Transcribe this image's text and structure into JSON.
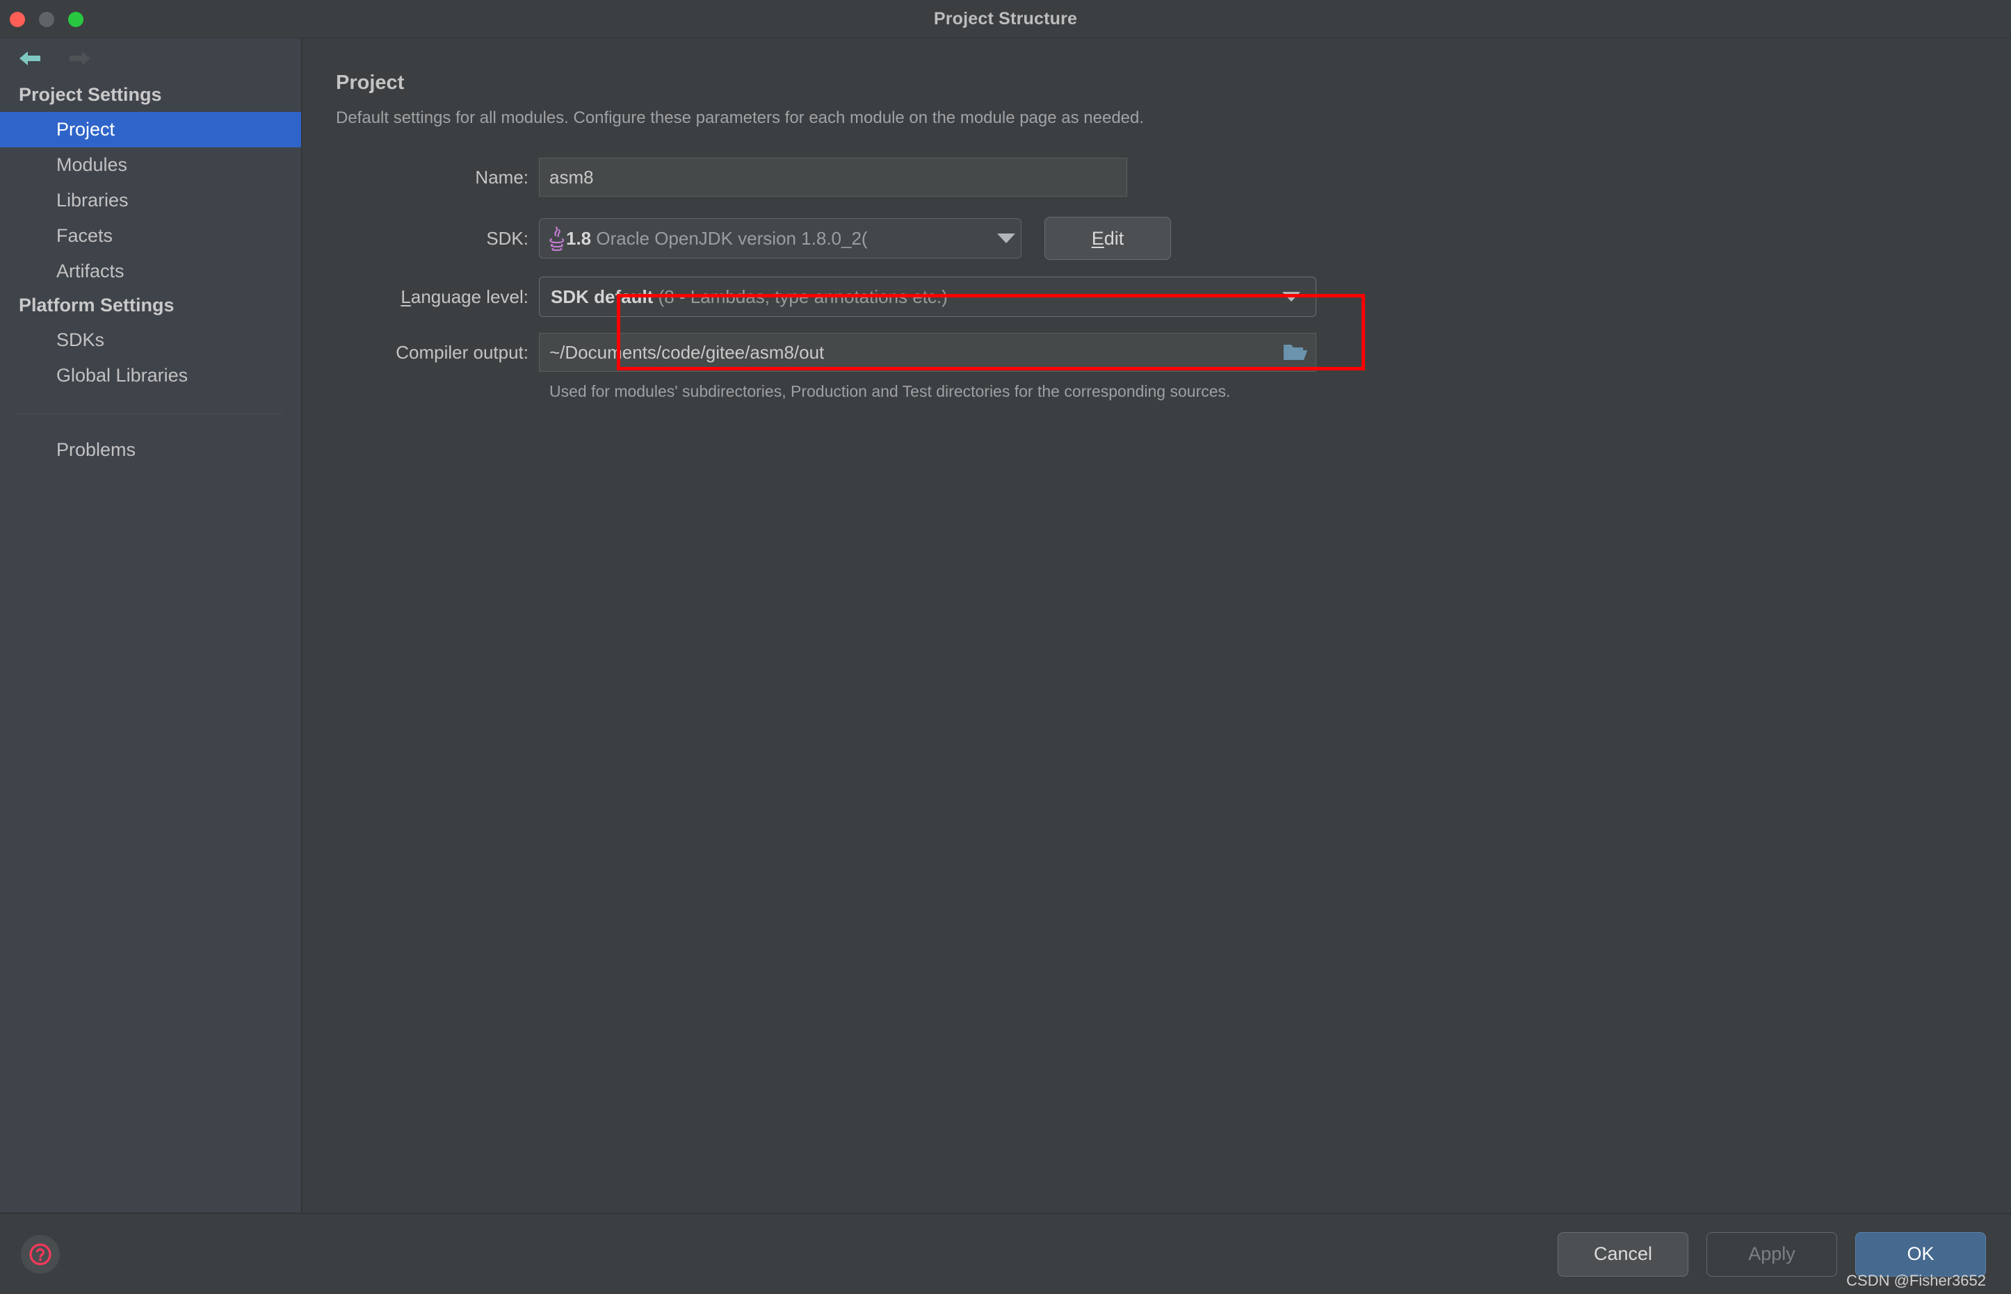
{
  "window": {
    "title": "Project Structure",
    "traffic_lights": [
      "close",
      "minimize",
      "zoom"
    ]
  },
  "nav": {
    "back_icon": "arrow-left-icon",
    "forward_icon": "arrow-right-icon",
    "back_color": "#7fc9c2",
    "forward_color": "#4f5356"
  },
  "sidebar": {
    "groups": [
      {
        "title": "Project Settings",
        "items": [
          {
            "label": "Project",
            "selected": true
          },
          {
            "label": "Modules",
            "selected": false
          },
          {
            "label": "Libraries",
            "selected": false
          },
          {
            "label": "Facets",
            "selected": false
          },
          {
            "label": "Artifacts",
            "selected": false
          }
        ]
      },
      {
        "title": "Platform Settings",
        "items": [
          {
            "label": "SDKs",
            "selected": false
          },
          {
            "label": "Global Libraries",
            "selected": false
          }
        ]
      }
    ],
    "extra_items": [
      {
        "label": "Problems",
        "selected": false
      }
    ],
    "selected_color": "#2f65ca"
  },
  "main": {
    "title": "Project",
    "description": "Default settings for all modules. Configure these parameters for each module on the module page as needed.",
    "name_row": {
      "label": "Name:",
      "value": "asm8"
    },
    "sdk_row": {
      "label": "SDK:",
      "icon": "java-icon",
      "value_strong": "1.8",
      "value_muted": "Oracle OpenJDK version 1.8.0_2(",
      "caret": "chevron-down-icon",
      "edit_button": "Edit",
      "edit_mnemonic": "E",
      "highlight_color": "#ff0000"
    },
    "language_row": {
      "label": "Language level:",
      "label_mnemonic": "L",
      "value_strong": "SDK default",
      "value_muted": "(8 - Lambdas, type annotations etc.)",
      "caret": "chevron-down-icon"
    },
    "compiler_row": {
      "label": "Compiler output:",
      "value": "~/Documents/code/gitee/asm8/out",
      "browse_icon": "folder-icon",
      "hint": "Used for modules' subdirectories, Production and Test directories for the corresponding sources."
    }
  },
  "footer": {
    "help_icon": "question-mark-icon",
    "help_color": "#f4395b",
    "buttons": [
      {
        "label": "Cancel",
        "style": "default",
        "enabled": true
      },
      {
        "label": "Apply",
        "style": "disabled",
        "enabled": false
      },
      {
        "label": "OK",
        "style": "primary",
        "enabled": true
      }
    ],
    "ok_color": "#45698f"
  },
  "watermark": "CSDN @Fisher3652"
}
